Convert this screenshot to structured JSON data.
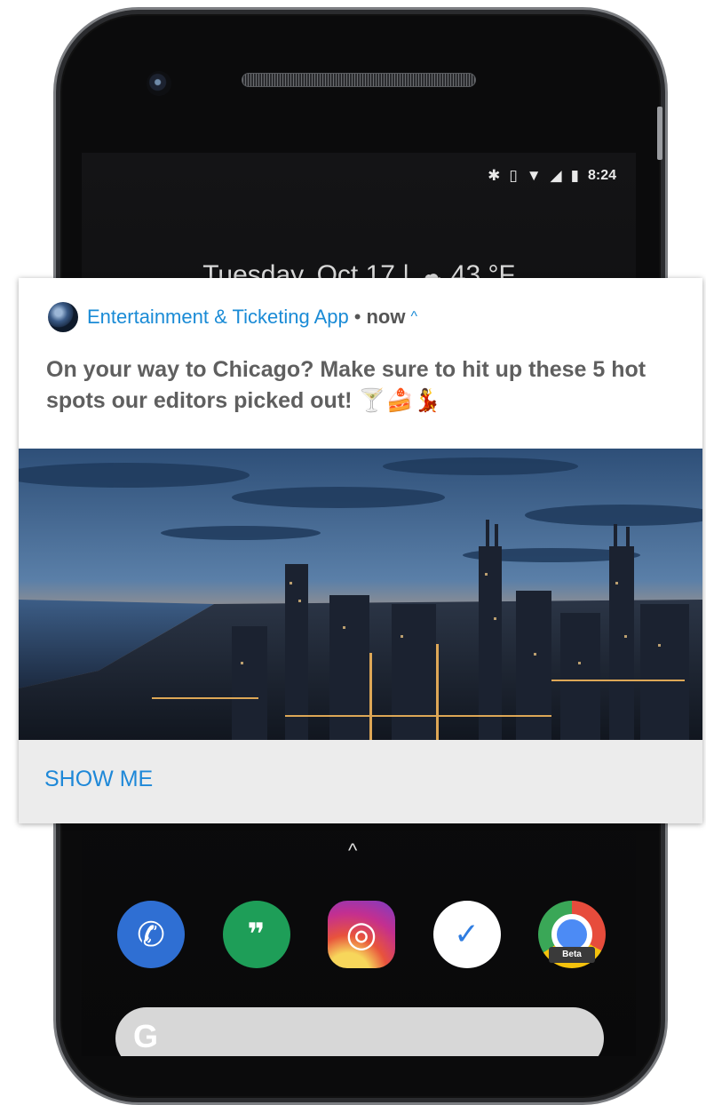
{
  "status_bar": {
    "bluetooth_icon": "bluetooth-icon",
    "vibrate_icon": "vibrate-icon",
    "wifi_icon": "wifi-icon",
    "signal_icon": "signal-icon",
    "battery_icon": "battery-icon",
    "time": "8:24"
  },
  "lock_screen": {
    "date_line": "Tuesday, Oct 17 | ☁ 43 °F"
  },
  "notification": {
    "app_name": "Entertainment & Ticketing  App",
    "separator": "•",
    "time": "now",
    "expand_icon": "chevron-up-icon",
    "message": "On your way to Chicago? Make sure to hit up these 5 hot spots our editors picked out! ",
    "emojis": "🍸🍰💃",
    "image_subject": "chicago-skyline-dusk",
    "action_label": "SHOW ME"
  },
  "dock": {
    "apps": [
      "Phone",
      "Hangouts",
      "Instagram",
      "Inbox",
      "Chrome Beta"
    ],
    "chrome_badge": "Beta",
    "search_glyph": "G"
  },
  "colors": {
    "accent": "#1a8bd6",
    "action": "#1e88d8",
    "message_text": "#5f5f5f",
    "actions_bg": "#ececec"
  }
}
